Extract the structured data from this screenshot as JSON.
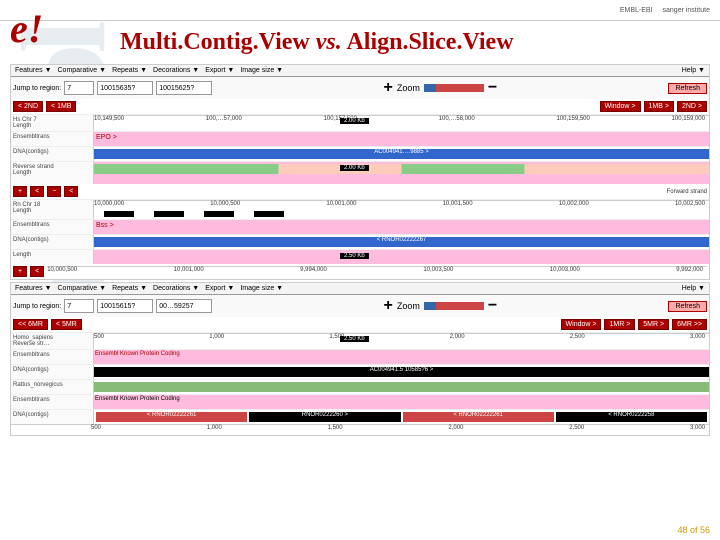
{
  "topbar": {
    "ebi": "EMBL-EBI",
    "sanger": "sanger institute"
  },
  "title_a": "Multi.Contig.View ",
  "title_vs": "vs.",
  "title_b": " Align.Slice.View",
  "logo": "e!",
  "watermark": "Ensembl",
  "menu": {
    "features": "Features ▼",
    "comparative": "Comparative ▼",
    "repeats": "Repeats ▼",
    "decorations": "Decorations ▼",
    "export": "Export ▼",
    "imgsize": "Image size ▼",
    "help": "Help ▼"
  },
  "jump": {
    "label": "Jump to region:",
    "chr": "7",
    "from": "10015635?",
    "to": "10015625?",
    "refresh": "Refresh"
  },
  "zoom": {
    "label": "Zoom",
    "plus": "+",
    "minus": "−"
  },
  "nav": {
    "l2": "< 2ND",
    "l1": "< 1MB",
    "win": "Window >",
    "r1": "1MB >",
    "r2": "2ND >"
  },
  "meta1": {
    "title": "Hs Chr 7",
    "length": "Length"
  },
  "ruler1": [
    "10,149,500",
    "100,…57,000",
    "100,157,500",
    "100,…58,000",
    "100,159,500",
    "100,159,000"
  ],
  "tracks": {
    "ens": "Ensembltrans",
    "dna": "DNA(contigs)",
    "rev": "Reverse\nstrand",
    "length": "Length",
    "epo": "EPO >",
    "forward": "Forward strand",
    "contig1": "AC004941.…9885 >",
    "scale1": "2.00 Kb",
    "scale2": "2.50 Kb"
  },
  "meta2": {
    "title": "Rn Chr 18",
    "length": "Length"
  },
  "ruler2": [
    "10,000,000",
    "10,000,500",
    "10,001,000",
    "10,001,500",
    "10,002,000",
    "10,002,500"
  ],
  "ruler2b": [
    "10,000,500",
    "10,001,000",
    "9,994,000",
    "10,003,500",
    "10,003,000",
    "9,992,000"
  ],
  "bss": "Bss >",
  "rno": "< RNOR02222267",
  "menu2": {
    "features": "Features ▼",
    "comparative": "Comparative ▼",
    "repeats": "Repeats ▼",
    "decorations": "Decorations ▼",
    "export": "Export ▼",
    "imgsize": "Image size ▼",
    "help": "Help ▼"
  },
  "jump2": {
    "chr": "7",
    "from": "10015615?",
    "to": "00…59257"
  },
  "nav2": {
    "ll": "<< 6MR",
    "l": "< 5MR",
    "win": "Window >",
    "r1": "1MR >",
    "r2": "5MR >",
    "r3": "6MR >>"
  },
  "meta3": {
    "title": "Homo_sapiens",
    "rev": "Reverse str…"
  },
  "ruler3": [
    "500",
    "1,000",
    "1,500",
    "2,000",
    "2,500",
    "3,000"
  ],
  "contig3": "AC004941.5 10585?6 >",
  "tracks3": {
    "ensprot": "Ensembl Known Protein Coding"
  },
  "meta4": {
    "title": "Rattus_norvegicus"
  },
  "contig4a": "< RNOR02222261",
  "contig4b": "RNOR0222260 >",
  "contig4c": "< RNOR02222261",
  "contig4d": "< RNOR0222258",
  "ruler4": [
    "500",
    "1,000",
    "1,500",
    "2,000",
    "2,500",
    "3,000"
  ],
  "pageno": "48 of 56"
}
